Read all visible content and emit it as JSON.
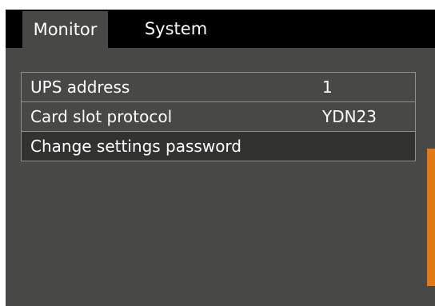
{
  "tabs": [
    {
      "label": "Monitor",
      "active": true
    },
    {
      "label": "System",
      "active": false
    }
  ],
  "settings": [
    {
      "label": "UPS address",
      "value": "1"
    },
    {
      "label": "Card slot protocol",
      "value": "YDN23"
    },
    {
      "label": "Change settings password",
      "value": "",
      "selected": true
    }
  ],
  "colors": {
    "background": "#484946",
    "tab_bar": "#000000",
    "selected_row": "#323331",
    "scrollbar": "#e07a12",
    "border": "#8e8e8c"
  }
}
